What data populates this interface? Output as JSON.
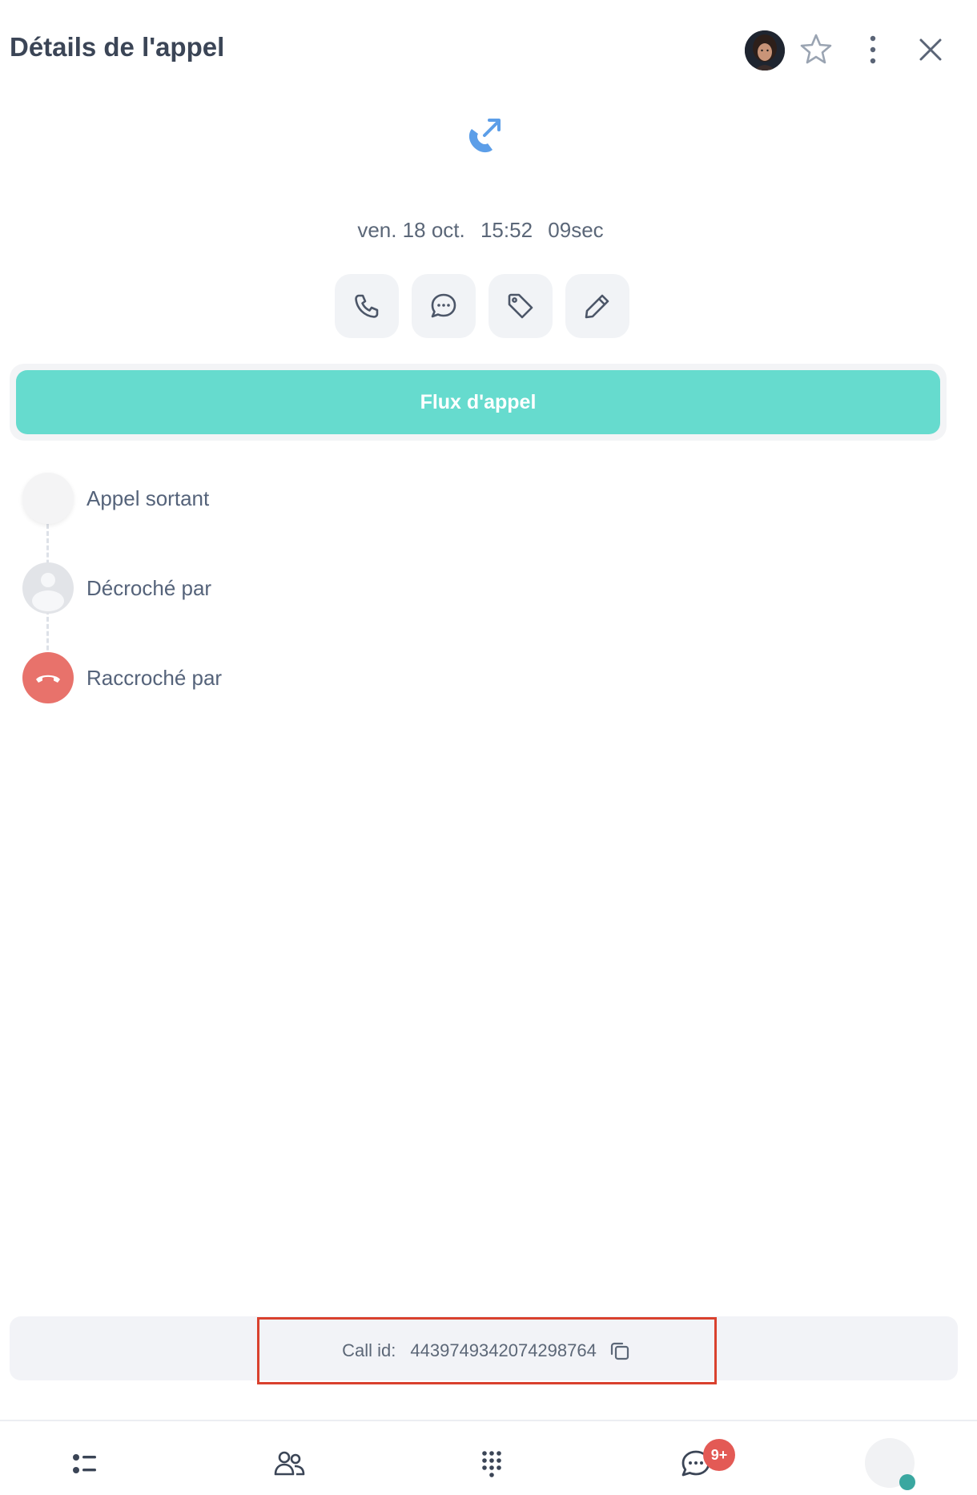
{
  "header": {
    "title": "Détails de l'appel"
  },
  "call": {
    "direction_icon": "outgoing-call-icon",
    "date": "ven. 18 oct.",
    "time": "15:52",
    "duration": "09sec"
  },
  "actions": [
    {
      "icon": "phone-icon"
    },
    {
      "icon": "message-icon"
    },
    {
      "icon": "tag-icon"
    },
    {
      "icon": "pencil-icon"
    }
  ],
  "flux_button": "Flux d'appel",
  "timeline": [
    {
      "label": "Appel sortant"
    },
    {
      "label": "Décroché par"
    },
    {
      "label": "Raccroché par"
    }
  ],
  "call_id": {
    "label": "Call id:",
    "value": "4439749342074298764"
  },
  "bottom_nav": {
    "items": [
      "list-icon",
      "contacts-icon",
      "dialpad-icon",
      "chat-icon",
      "profile-avatar"
    ],
    "chat_badge": "9+"
  },
  "colors": {
    "accent": "#66dbce",
    "call_icon": "#5c9ee8",
    "hangup": "#e8726b",
    "badge": "#e35a55",
    "status": "#3aa7a0",
    "highlight": "#d9412e"
  }
}
